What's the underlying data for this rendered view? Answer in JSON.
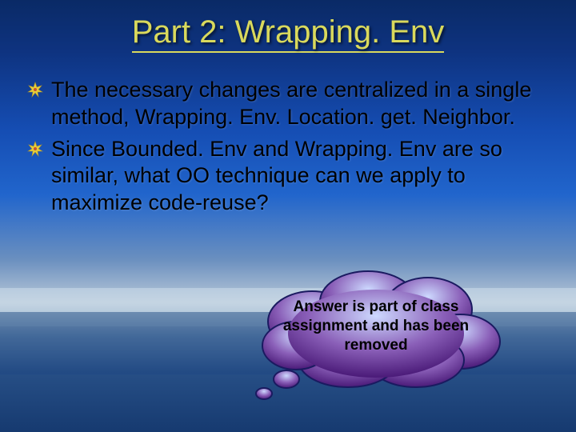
{
  "title_prefix": "Part 2: Wrapping. Env",
  "bullets": [
    "The necessary changes are centralized in a single method, Wrapping. Env. Location. get. Neighbor.",
    "Since Bounded. Env and Wrapping. Env are so similar, what OO technique can we apply to maximize code-reuse?"
  ],
  "callout": "Answer is part of class assignment and has been removed",
  "colors": {
    "title": "#d9d95c",
    "cloud_fill_top": "#b3c4ff",
    "cloud_fill_bottom": "#6a1a9a",
    "cloud_stroke": "#1a1a60"
  }
}
